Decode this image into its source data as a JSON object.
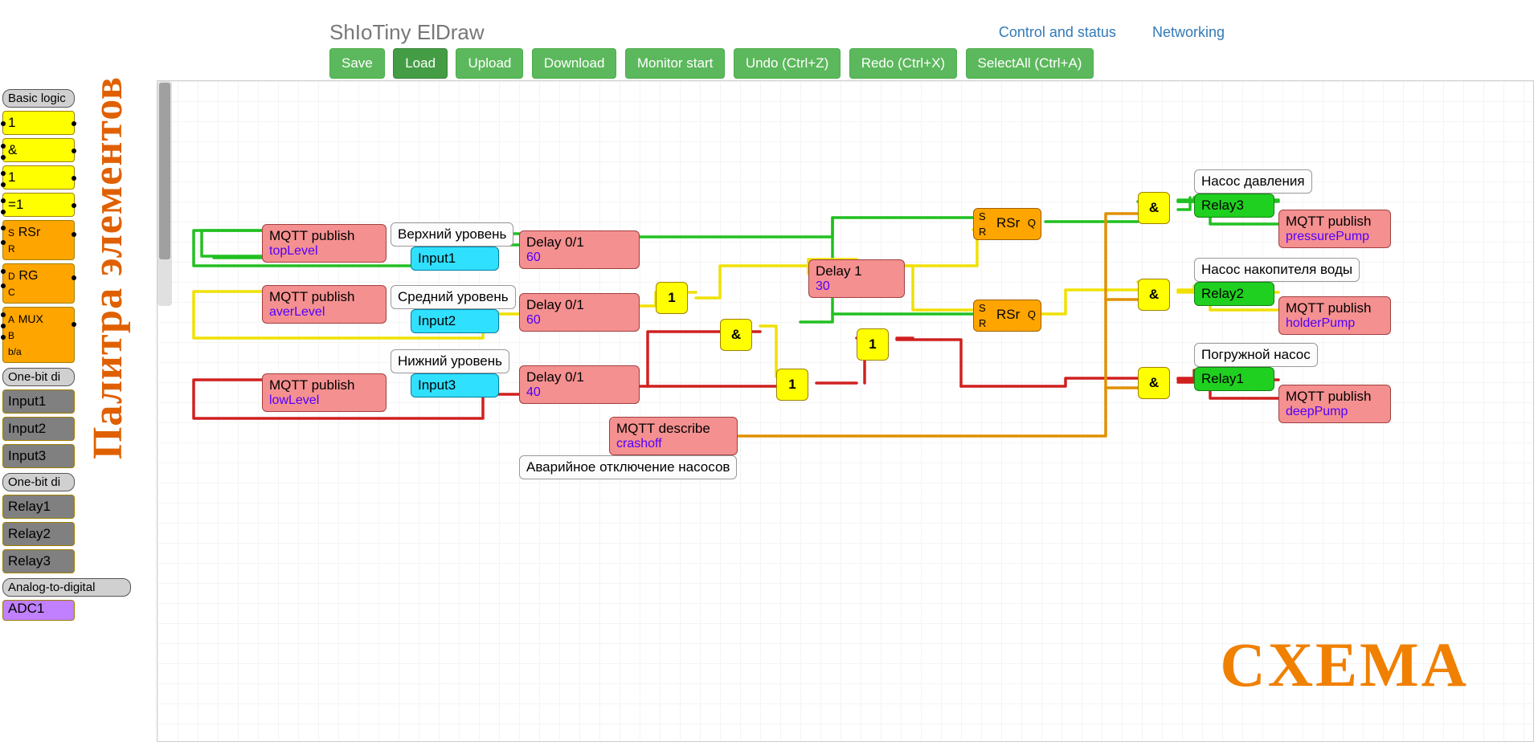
{
  "app": {
    "title": "ShIoTiny ElDraw"
  },
  "nav": {
    "control": "Control and status",
    "net": "Networking"
  },
  "buttons": {
    "save": "Save",
    "load": "Load",
    "upload": "Upload",
    "download": "Download",
    "monstart": "Monitor start",
    "undo": "Undo (Ctrl+Z)",
    "redo": "Redo (Ctrl+X)",
    "selall": "SelectAll (Ctrl+A)"
  },
  "palette": {
    "title": "Палитра элементов",
    "heads": {
      "basic": "Basic logic",
      "onebitin": "One-bit di",
      "onebitout": "One-bit di",
      "adc": "Analog-to-digital"
    },
    "blocks": {
      "or": "1",
      "and": "&",
      "buf": "1",
      "xor": "=1",
      "rsr_s": "S",
      "rsr_r": "R",
      "rsr": "RSr",
      "rg_d": "D",
      "rg_c": "C",
      "rg": "RG",
      "mux_a": "A",
      "mux_b": "B",
      "mux_ba": "b/a",
      "mux": "MUX",
      "in1": "Input1",
      "in2": "Input2",
      "in3": "Input3",
      "r1": "Relay1",
      "r2": "Relay2",
      "r3": "Relay3",
      "adc1": "ADC1"
    }
  },
  "schema": {
    "label": "CXEMA"
  },
  "nodes": {
    "mqtt_top": {
      "title": "MQTT publish",
      "sub": "topLevel"
    },
    "mqtt_aver": {
      "title": "MQTT publish",
      "sub": "averLevel"
    },
    "mqtt_low": {
      "title": "MQTT publish",
      "sub": "lowLevel"
    },
    "lbl_top": "Верхний уровень",
    "lbl_mid": "Средний уровень",
    "lbl_low": "Нижний уровень",
    "in1": "Input1",
    "in2": "Input2",
    "in3": "Input3",
    "d1": {
      "title": "Delay 0/1",
      "sub": "60"
    },
    "d2": {
      "title": "Delay 0/1",
      "sub": "60"
    },
    "d3": {
      "title": "Delay 0/1",
      "sub": "40"
    },
    "d1sec": {
      "title": "Delay 1",
      "sub": "30"
    },
    "or1": "1",
    "or2": "1",
    "or3": "1",
    "and1": "&",
    "and2": "&",
    "and3": "&",
    "and4": "&",
    "rsr1": {
      "s": "S",
      "r": "R",
      "q": "Q",
      "name": "RSr"
    },
    "rsr2": {
      "s": "S",
      "r": "R",
      "q": "Q",
      "name": "RSr"
    },
    "mqtt_desc": {
      "title": "MQTT describe",
      "sub": "crashoff"
    },
    "lbl_crash": "Аварийное отключение насосов",
    "lbl_press": "Насос давления",
    "lbl_hold": "Насос накопителя воды",
    "lbl_deep": "Погружной насос",
    "relay1": "Relay1",
    "relay2": "Relay2",
    "relay3": "Relay3",
    "mqtt_press": {
      "title": "MQTT publish",
      "sub": "pressurePump"
    },
    "mqtt_hold": {
      "title": "MQTT publish",
      "sub": "holderPump"
    },
    "mqtt_deep": {
      "title": "MQTT publish",
      "sub": "deepPump"
    }
  }
}
